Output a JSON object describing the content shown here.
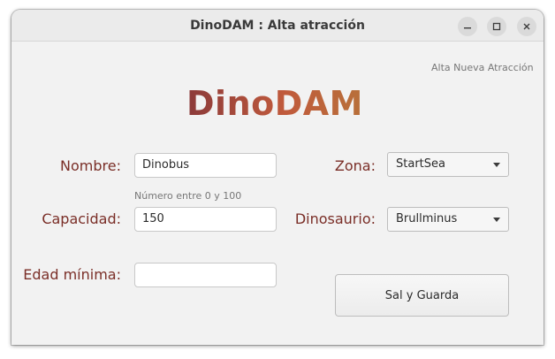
{
  "window": {
    "title": "DinoDAM : Alta atracción"
  },
  "header": {
    "hint": "Alta Nueva Atracción",
    "logo": "DinoDAM"
  },
  "form": {
    "nombre": {
      "label": "Nombre:",
      "value": "Dinobus"
    },
    "capacidad": {
      "label": "Capacidad:",
      "hint": "Número entre 0 y 100",
      "value": "150"
    },
    "edad": {
      "label": "Edad mínima:",
      "value": ""
    },
    "zona": {
      "label": "Zona:",
      "selected": "StartSea"
    },
    "dinosaurio": {
      "label": "Dinosaurio:",
      "selected": "Brullminus"
    },
    "save_label": "Sal y Guarda"
  },
  "icons": {
    "minimize": "minimize-icon",
    "maximize": "maximize-icon",
    "close": "close-icon",
    "dropdown": "chevron-down-icon"
  },
  "colors": {
    "label": "#7a2e27",
    "logo_start": "#8b3a3a",
    "logo_end": "#b8703a",
    "window_bg": "#f2f2f2"
  }
}
